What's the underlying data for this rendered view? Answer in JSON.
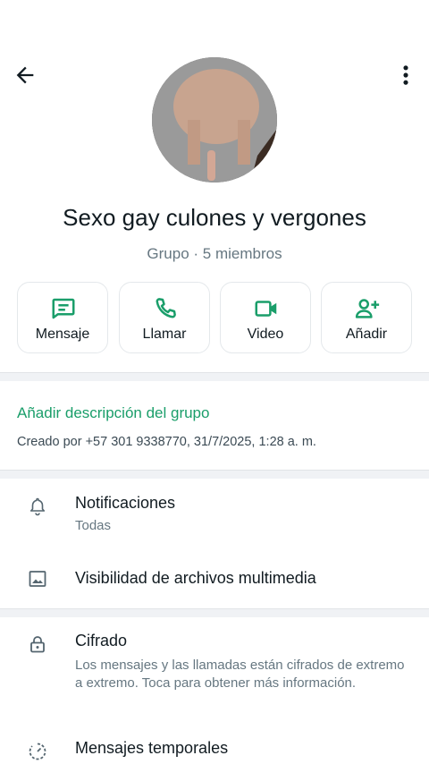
{
  "header": {
    "group_name": "Sexo gay culones y vergones",
    "group_meta": "Grupo · 5 miembros"
  },
  "actions": [
    {
      "label": "Mensaje",
      "icon": "message-icon"
    },
    {
      "label": "Llamar",
      "icon": "phone-icon"
    },
    {
      "label": "Video",
      "icon": "video-icon"
    },
    {
      "label": "Añadir",
      "icon": "add-person-icon"
    }
  ],
  "description": {
    "add_link": "Añadir descripción del grupo",
    "created_by": "Creado por +57 301 9338770, 31/7/2025, 1:28 a. m."
  },
  "settings": {
    "notifications_title": "Notificaciones",
    "notifications_value": "Todas",
    "media_visibility_title": "Visibilidad de archivos multimedia"
  },
  "security": {
    "encryption_title": "Cifrado",
    "encryption_text": "Los mensajes y las llamadas están cifrados de extremo a extremo. Toca para obtener más información.",
    "temporal_title": "Mensajes temporales"
  },
  "colors": {
    "accent": "#1a9e6a",
    "text_primary": "#111b21",
    "text_secondary": "#667781",
    "divider": "#f0f2f5"
  }
}
